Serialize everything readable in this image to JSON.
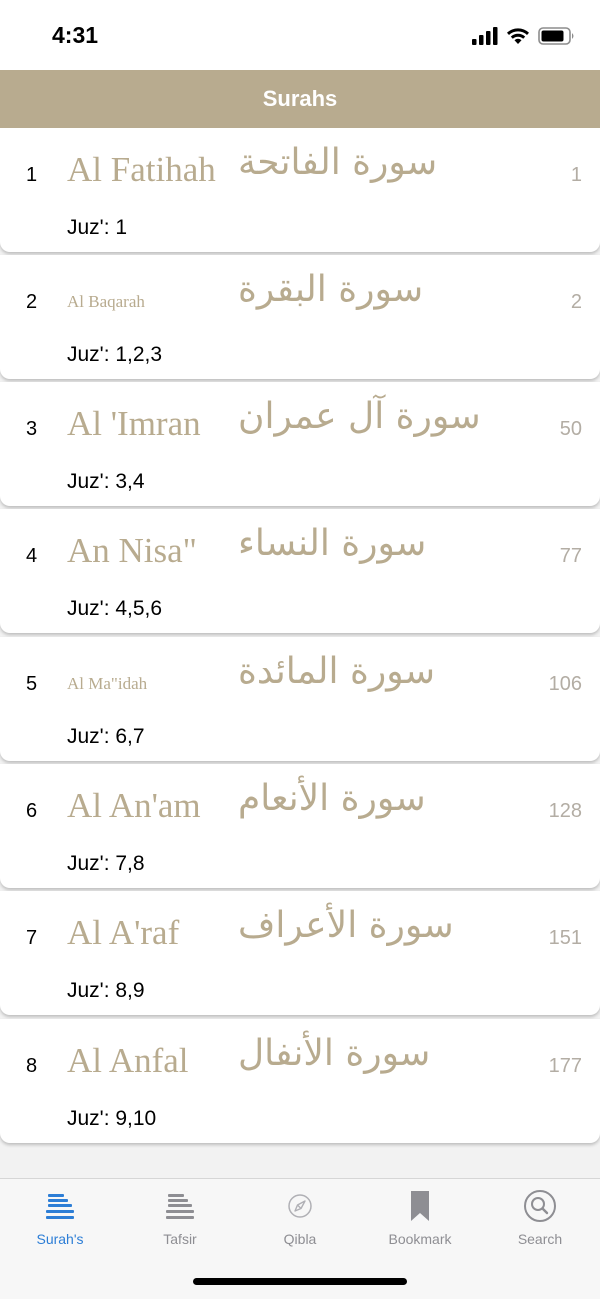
{
  "status_bar": {
    "time": "4:31"
  },
  "header": {
    "title": "Surahs"
  },
  "surahs": [
    {
      "number": "1",
      "name": "Al Fatihah",
      "arabic": "سورة الفاتحة",
      "ayah": "1",
      "juz": "Juz': 1"
    },
    {
      "number": "2",
      "name": "Al Baqarah",
      "arabic": "سورة البقرة",
      "ayah": "2",
      "juz": "Juz': 1,2,3"
    },
    {
      "number": "3",
      "name": "Al 'Imran",
      "arabic": "سورة آل عمران",
      "ayah": "50",
      "juz": "Juz': 3,4"
    },
    {
      "number": "4",
      "name": "An Nisa\"",
      "arabic": "سورة النساء",
      "ayah": "77",
      "juz": "Juz': 4,5,6"
    },
    {
      "number": "5",
      "name": "Al Ma\"idah",
      "arabic": "سورة المائدة",
      "ayah": "106",
      "juz": "Juz': 6,7"
    },
    {
      "number": "6",
      "name": "Al An'am",
      "arabic": "سورة الأنعام",
      "ayah": "128",
      "juz": "Juz': 7,8"
    },
    {
      "number": "7",
      "name": "Al A'raf",
      "arabic": "سورة الأعراف",
      "ayah": "151",
      "juz": "Juz': 8,9"
    },
    {
      "number": "8",
      "name": "Al Anfal",
      "arabic": "سورة الأنفال",
      "ayah": "177",
      "juz": "Juz': 9,10"
    }
  ],
  "tabs": [
    {
      "label": "Surah's",
      "icon": "book-stack-icon",
      "active": true
    },
    {
      "label": "Tafsir",
      "icon": "book-stack-icon",
      "active": false
    },
    {
      "label": "Qibla",
      "icon": "compass-icon",
      "active": false
    },
    {
      "label": "Bookmark",
      "icon": "bookmark-icon",
      "active": false
    },
    {
      "label": "Search",
      "icon": "search-icon",
      "active": false
    }
  ],
  "colors": {
    "header_bg": "#b8ab8f",
    "accent_text": "#b8ab8f",
    "tab_active": "#2d7ed6",
    "tab_inactive": "#8e8e93"
  }
}
